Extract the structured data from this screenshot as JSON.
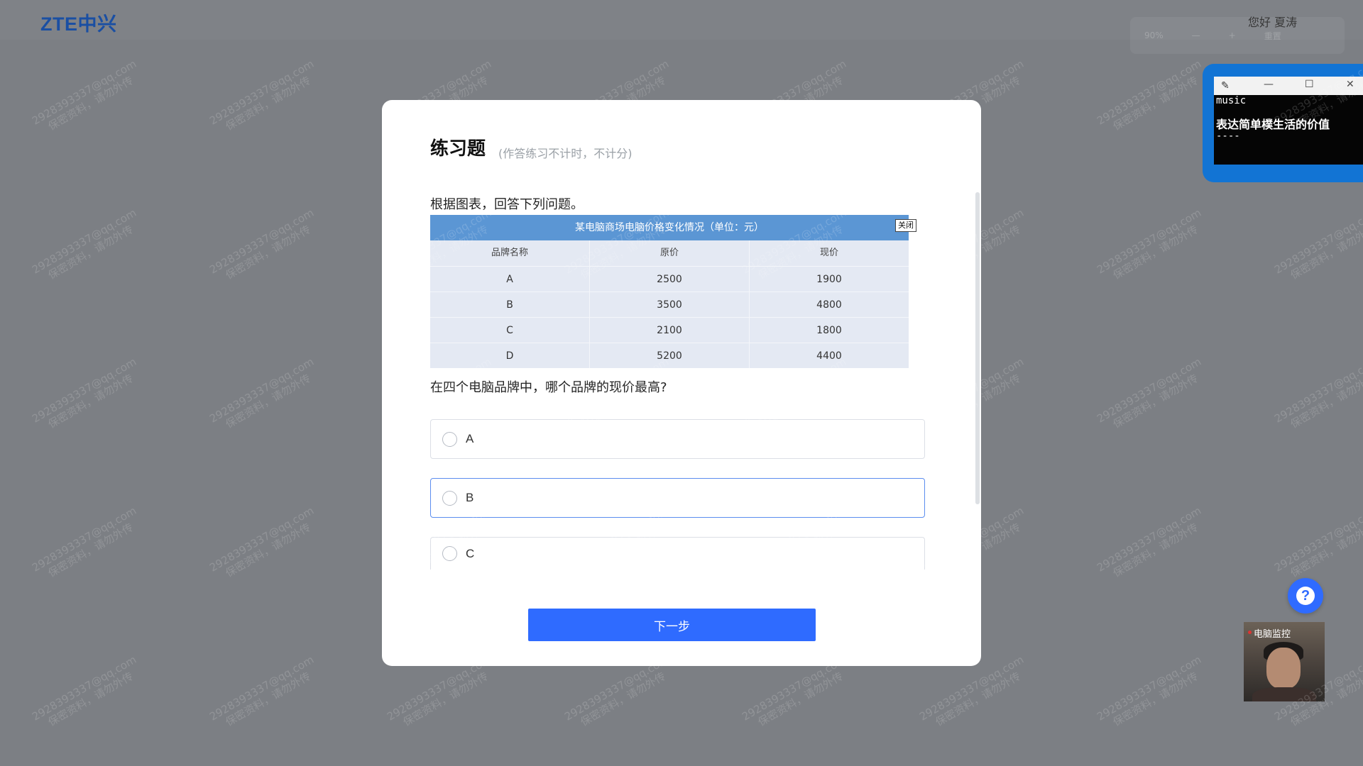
{
  "header": {
    "logo": "ZTE中兴",
    "greeting": "您好 夏涛",
    "ghost_toolbar": [
      "90%",
      "—",
      "+",
      "重置"
    ]
  },
  "watermark": {
    "line1": "2928393337@qq.com",
    "line2": "保密资料，请勿外传"
  },
  "modal": {
    "title": "练习题",
    "subtitle": "(作答练习不计时，不计分)",
    "question_intro": "根据图表，回答下列问题。",
    "table": {
      "caption": "某电脑商场电脑价格变化情况（单位：元）",
      "close_label": "关闭",
      "headers": [
        "品牌名称",
        "原价",
        "现价"
      ],
      "rows": [
        [
          "A",
          "2500",
          "1900"
        ],
        [
          "B",
          "3500",
          "4800"
        ],
        [
          "C",
          "2100",
          "1800"
        ],
        [
          "D",
          "5200",
          "4400"
        ]
      ]
    },
    "question": "在四个电脑品牌中，哪个品牌的现价最高?",
    "options": [
      {
        "label": "A",
        "selected": false
      },
      {
        "label": "B",
        "selected": false
      },
      {
        "label": "C",
        "selected": false
      }
    ],
    "next_button": "下一步"
  },
  "mini_window": {
    "line1": "music",
    "line2": "表达简单樸生活的价值",
    "line3": "----"
  },
  "help": {
    "icon": "question-circle-icon",
    "glyph": "?"
  },
  "webcam": {
    "label": "电脑监控"
  },
  "colors": {
    "backdrop": "#7c7f84",
    "primary": "#2f6bff",
    "table_caption": "#5b96d4",
    "mini_frame": "#1274d4"
  }
}
